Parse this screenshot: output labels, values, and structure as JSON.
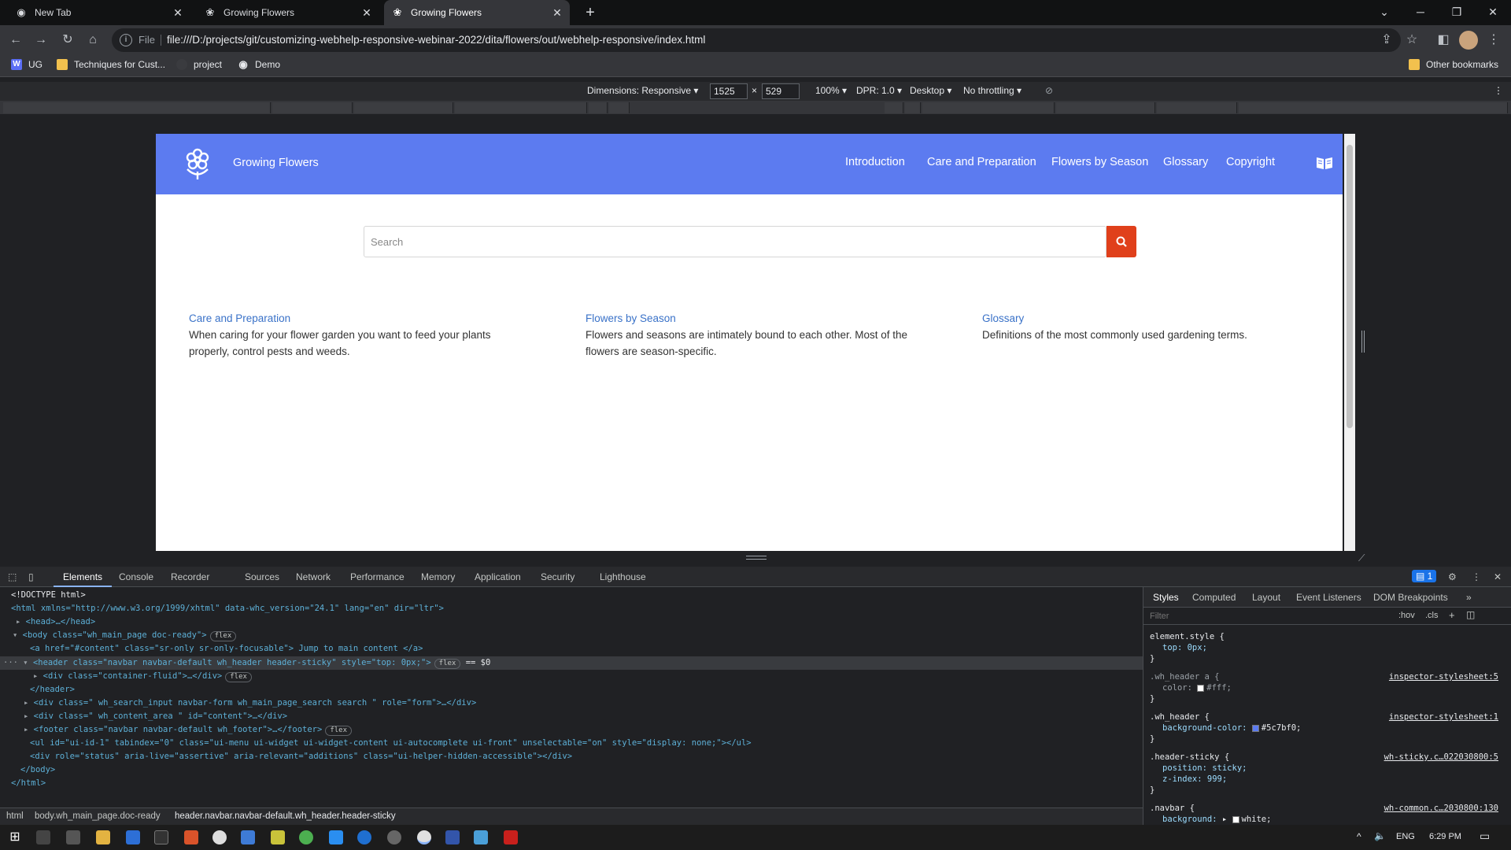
{
  "browser": {
    "tabs": [
      {
        "title": "New Tab"
      },
      {
        "title": "Growing Flowers"
      },
      {
        "title": "Growing Flowers"
      }
    ],
    "address": {
      "scheme": "File",
      "url": "file:///D:/projects/git/customizing-webhelp-responsive-webinar-2022/dita/flowers/out/webhelp-responsive/index.html"
    },
    "bookmarks": [
      "UG",
      "Techniques for Cust...",
      "project",
      "Demo"
    ],
    "other_bookmarks": "Other bookmarks"
  },
  "device_toolbar": {
    "dimensions_label": "Dimensions: Responsive",
    "width": "1525",
    "times": "×",
    "height": "529",
    "zoom": "100%",
    "dpr": "DPR: 1.0",
    "device": "Desktop",
    "throttling": "No throttling"
  },
  "site": {
    "title": "Growing Flowers",
    "nav": [
      "Introduction",
      "Care and Preparation",
      "Flowers by Season",
      "Glossary",
      "Copyright"
    ],
    "search_placeholder": "Search",
    "cards": [
      {
        "title": "Care and Preparation",
        "desc": "When caring for your flower garden you want to feed your plants properly, control pests and weeds."
      },
      {
        "title": "Flowers by Season",
        "desc": "Flowers and seasons are intimately bound to each other. Most of the flowers are season-specific."
      },
      {
        "title": "Glossary",
        "desc": "Definitions of the most commonly used gardening terms."
      }
    ],
    "header_color": "#5c7bf0",
    "search_button_color": "#e0401b"
  },
  "devtools": {
    "tabs": [
      "Elements",
      "Console",
      "Recorder",
      "Sources",
      "Network",
      "Performance",
      "Memory",
      "Application",
      "Security",
      "Lighthouse"
    ],
    "issues_count": "1",
    "dom": {
      "doctype": "<!DOCTYPE html>",
      "html_open": "<html xmlns=\"http://www.w3.org/1999/xhtml\" data-whc_version=\"24.1\" lang=\"en\" dir=\"ltr\">",
      "head": "<head>…</head>",
      "body_open": "<body class=\"wh_main_page doc-ready\">",
      "skip_link": "<a href=\"#content\" class=\"sr-only sr-only-focusable\"> Jump to main content </a>",
      "header_open": "<header class=\"navbar navbar-default wh_header header-sticky\" style=\"top: 0px;\">",
      "selected_marker": "== $0",
      "container": "<div class=\"container-fluid\">…</div>",
      "header_close": "</header>",
      "search_div": "<div class=\" wh_search_input navbar-form wh_main_page_search search \" role=\"form\">…</div>",
      "content_div": "<div class=\" wh_content_area \" id=\"content\">…</div>",
      "footer": "<footer class=\"navbar navbar-default wh_footer\">…</footer>",
      "ul": "<ul id=\"ui-id-1\" tabindex=\"0\" class=\"ui-menu ui-widget ui-widget-content ui-autocomplete ui-front\" unselectable=\"on\" style=\"display: none;\"></ul>",
      "status_div": "<div role=\"status\" aria-live=\"assertive\" aria-relevant=\"additions\" class=\"ui-helper-hidden-accessible\"></div>",
      "body_close": "</body>",
      "html_close": "</html>",
      "flex_badge": "flex"
    },
    "breadcrumbs": [
      "html",
      "body.wh_main_page.doc-ready",
      "header.navbar.navbar-default.wh_header.header-sticky"
    ],
    "styles_tabs": [
      "Styles",
      "Computed",
      "Layout",
      "Event Listeners",
      "DOM Breakpoints"
    ],
    "filter_placeholder": "Filter",
    "filter_tools": [
      ":hov",
      ".cls"
    ],
    "rules": {
      "r1_sel": "element.style {",
      "r1_prop": "top: 0px;",
      "r2_sel": ".wh_header a {",
      "r2_src": "inspector-stylesheet:5",
      "r2_prop": "color:",
      "r2_val": "#fff;",
      "r3_sel": ".wh_header {",
      "r3_src": "inspector-stylesheet:1",
      "r3_prop": "background-color:",
      "r3_val": "#5c7bf0;",
      "r4_sel": ".header-sticky {",
      "r4_src": "wh-sticky.c…022030800:5",
      "r4_p1": "position: sticky;",
      "r4_p2": "z-index: 999;",
      "r5_sel": ".navbar {",
      "r5_src": "wh-common.c…2030800:130",
      "r5_prop": "background:",
      "r5_val": "white;",
      "close": "}"
    }
  },
  "taskbar": {
    "lang": "ENG",
    "time": "6:29 PM"
  }
}
